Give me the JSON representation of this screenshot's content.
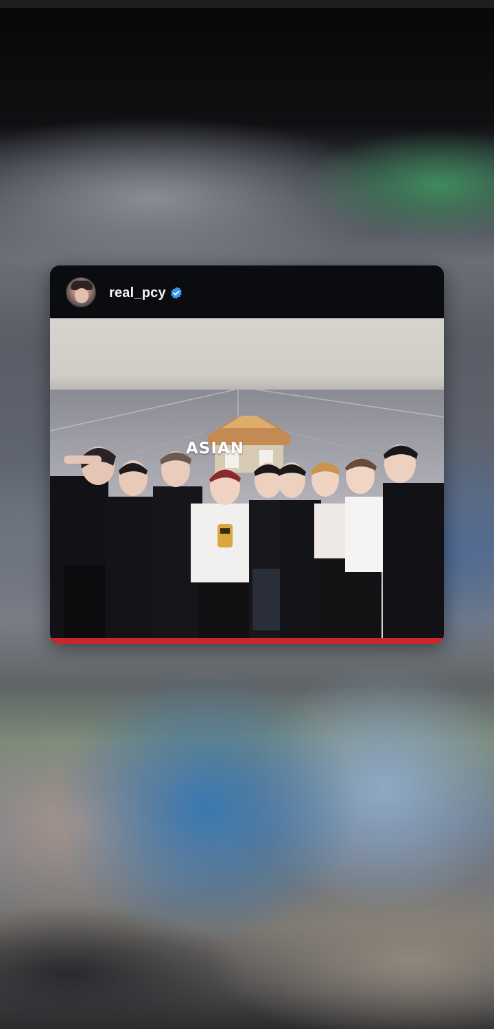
{
  "post": {
    "username": "real_pcy",
    "verified": true,
    "photo_backdrop_text": "ASIAN"
  },
  "icons": {
    "avatar": "avatar",
    "verified": "verified-badge-icon"
  },
  "colors": {
    "card_header": "#0b0c10",
    "verified_badge": "#3897f0",
    "username_text": "#f5f5f5"
  }
}
